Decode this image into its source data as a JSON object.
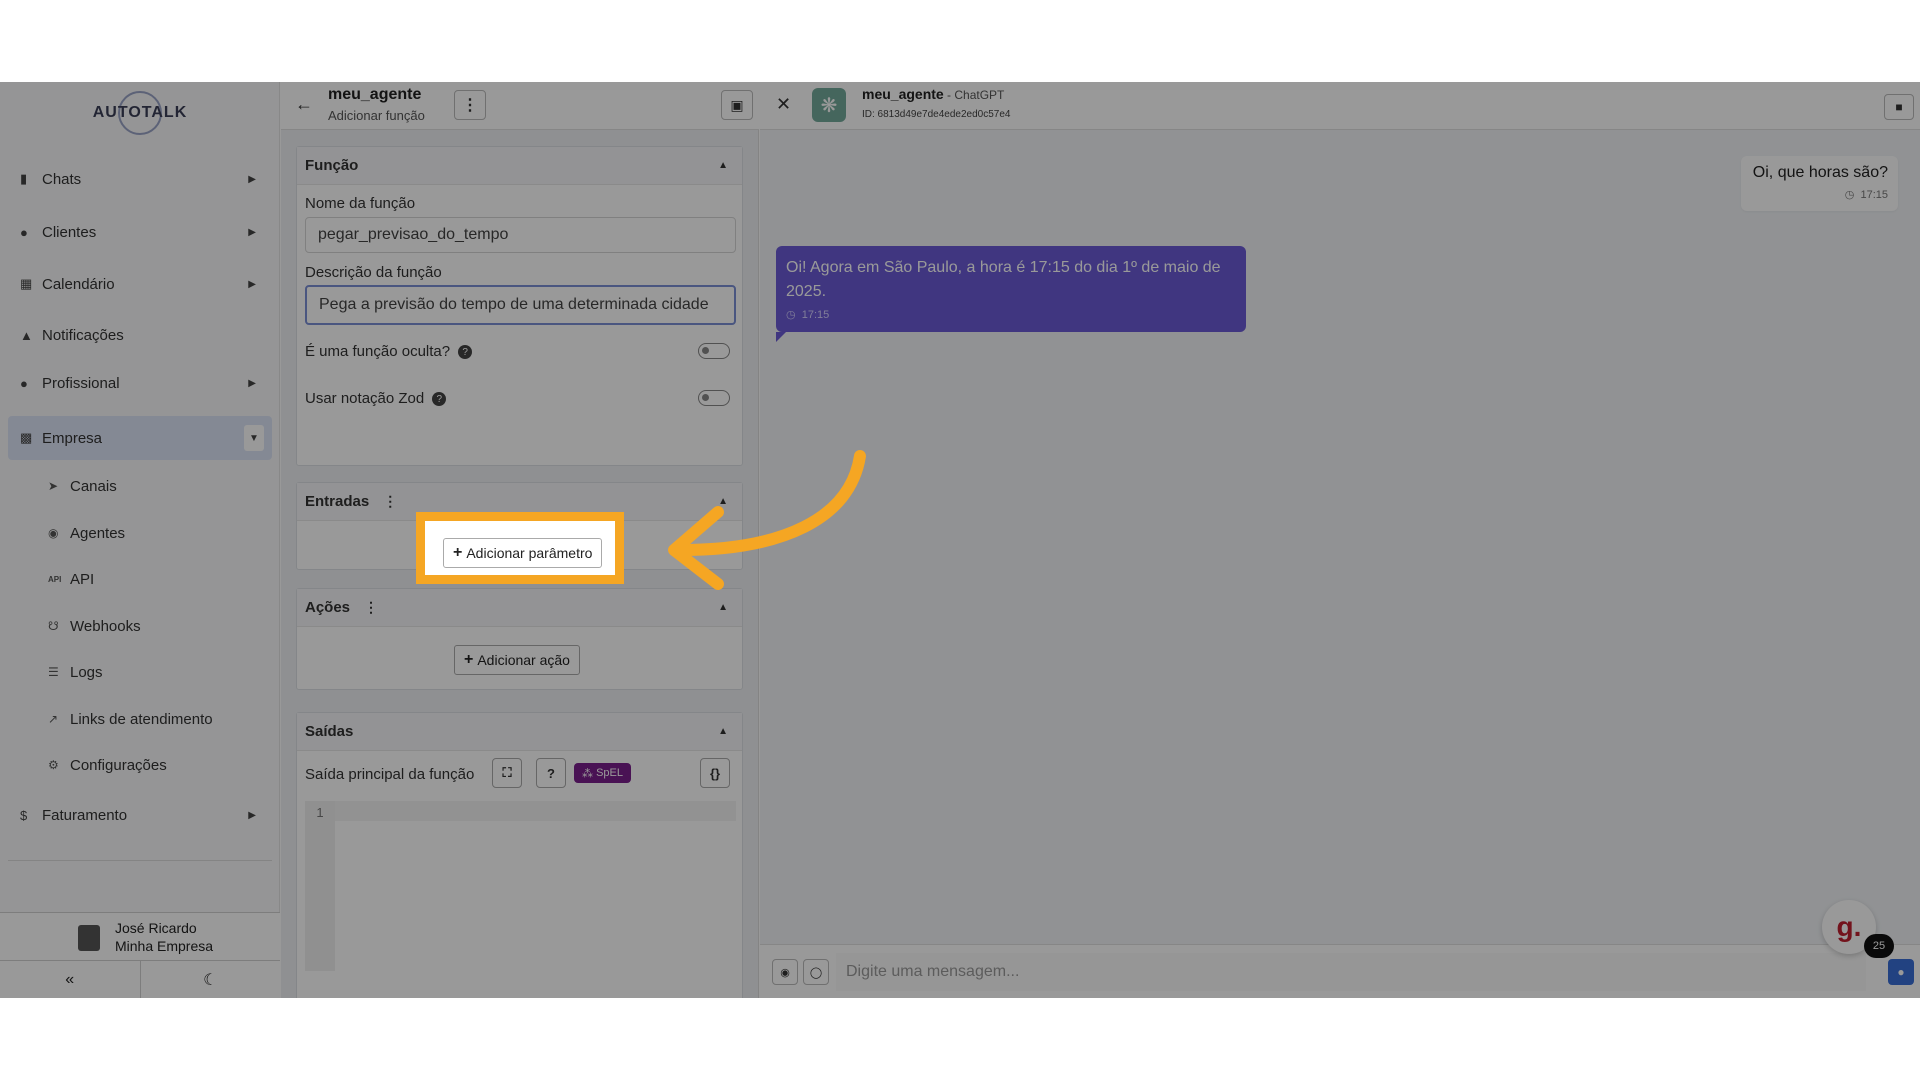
{
  "sidebar": {
    "logo": "AUTOTALK",
    "items": [
      {
        "label": "Chats",
        "icon": "chat-icon"
      },
      {
        "label": "Clientes",
        "icon": "users-icon"
      },
      {
        "label": "Calendário",
        "icon": "calendar-icon"
      },
      {
        "label": "Notificações",
        "icon": "bell-icon"
      },
      {
        "label": "Profissional",
        "icon": "user-tie-icon"
      },
      {
        "label": "Empresa",
        "icon": "building-icon"
      }
    ],
    "subitems": [
      {
        "label": "Canais",
        "icon": "rocket-icon"
      },
      {
        "label": "Agentes",
        "icon": "robot-icon"
      },
      {
        "label": "API",
        "icon": "api-icon"
      },
      {
        "label": "Webhooks",
        "icon": "webhook-icon"
      },
      {
        "label": "Logs",
        "icon": "list-icon"
      },
      {
        "label": "Links de atendimento",
        "icon": "external-link-icon"
      },
      {
        "label": "Configurações",
        "icon": "gear-icon"
      }
    ],
    "billing": {
      "label": "Faturamento",
      "icon": "dollar-icon"
    },
    "user": {
      "name": "José Ricardo",
      "company": "Minha Empresa"
    }
  },
  "editor": {
    "title": "meu_agente",
    "subtitle": "Adicionar função",
    "funcao": {
      "header": "Função",
      "name_label": "Nome da função",
      "name_value": "pegar_previsao_do_tempo",
      "desc_label": "Descrição da função",
      "desc_value": "Pega a previsão do tempo de uma determinada cidade",
      "hidden_label": "É uma função oculta?",
      "zod_label": "Usar notação Zod"
    },
    "entradas": {
      "header": "Entradas",
      "add_label": "Adicionar parâmetro"
    },
    "acoes": {
      "header": "Ações",
      "add_label": "Adicionar ação"
    },
    "saidas": {
      "header": "Saídas",
      "main_label": "Saída principal da função",
      "spel": "SpEL",
      "line_no": "1"
    }
  },
  "chat": {
    "agent": "meu_agente",
    "model": " - ChatGPT",
    "id": "ID: 6813d49e7de4ede2ed0c57e4",
    "user_msg": "Oi, que horas são?",
    "user_time": "17:15",
    "bot_msg": "Oi! Agora em São Paulo, a hora é 17:15 do dia 1º de maio de 2025.",
    "bot_time": "17:15",
    "placeholder": "Digite uma mensagem...",
    "badge_letter": "g.",
    "badge_count": "25"
  },
  "colors": {
    "highlight": "#f5a623",
    "bot_bubble": "#6b5bd6",
    "active_nav": "#dde4f7"
  }
}
